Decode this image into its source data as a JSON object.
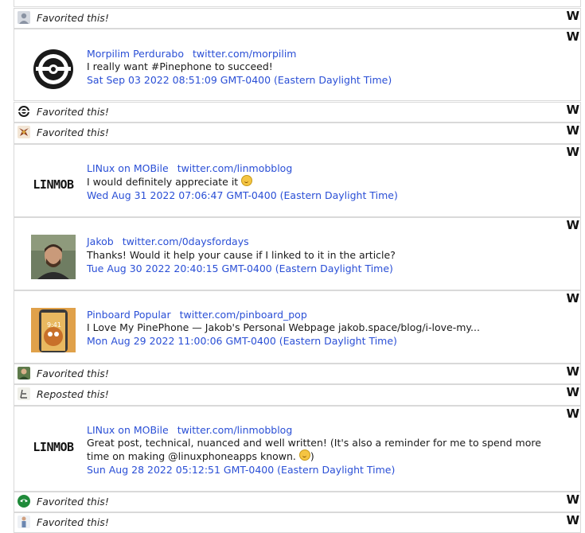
{
  "logo_glyph": "W",
  "rows": [
    {
      "type": "mini",
      "label": "Favorited this!",
      "icon": "avatar-generic-icon"
    },
    {
      "type": "post",
      "author": "Morpilim Perdurabo",
      "handle": "twitter.com/morpilim",
      "content": "I really want #Pinephone to succeed!",
      "date": "Sat Sep 03 2022 08:51:09 GMT-0400 (Eastern Daylight Time)",
      "avatar": "morpilim-logo-icon"
    },
    {
      "type": "mini",
      "label": "Favorited this!",
      "icon": "avatar-morpilim-icon"
    },
    {
      "type": "mini",
      "label": "Favorited this!",
      "icon": "avatar-creature-icon"
    },
    {
      "type": "post",
      "author": "LINux on MOBile",
      "handle": "twitter.com/linmobblog",
      "content": "I would definitely appreciate it",
      "date": "Wed Aug 31 2022 07:06:47 GMT-0400 (Eastern Daylight Time)",
      "avatar": "linmob-logo-icon",
      "emoji": "grinning-face-icon"
    },
    {
      "type": "post",
      "author": "Jakob",
      "handle": "twitter.com/0daysfordays",
      "content": "Thanks! Would it help your cause if I linked to it in the article?",
      "date": "Tue Aug 30 2022 20:40:15 GMT-0400 (Eastern Daylight Time)",
      "avatar": "jakob-photo-icon"
    },
    {
      "type": "post",
      "author": "Pinboard Popular",
      "handle": "twitter.com/pinboard_pop",
      "content": "I Love My PinePhone — Jakob's Personal Webpage jakob.space/blog/i-love-my...",
      "date": "Mon Aug 29 2022 11:00:06 GMT-0400 (Eastern Daylight Time)",
      "avatar": "pinboard-photo-icon",
      "avatar_time": "9:41"
    },
    {
      "type": "mini",
      "label": "Favorited this!",
      "icon": "avatar-person-icon"
    },
    {
      "type": "mini",
      "label": "Reposted this!",
      "icon": "avatar-sketch-icon"
    },
    {
      "type": "post",
      "author": "LINux on MOBile",
      "handle": "twitter.com/linmobblog",
      "content": "Great post, technical, nuanced and well written! (It's also a reminder for me to spend more time on making @linuxphoneapps known.",
      "content_tail": ")",
      "date": "Sun Aug 28 2022 05:12:51 GMT-0400 (Eastern Daylight Time)",
      "avatar": "linmob-logo-icon",
      "emoji": "slight-smile-icon"
    },
    {
      "type": "mini",
      "label": "Favorited this!",
      "icon": "avatar-green-icon"
    },
    {
      "type": "mini",
      "label": "Favorited this!",
      "icon": "avatar-figure-icon"
    }
  ]
}
